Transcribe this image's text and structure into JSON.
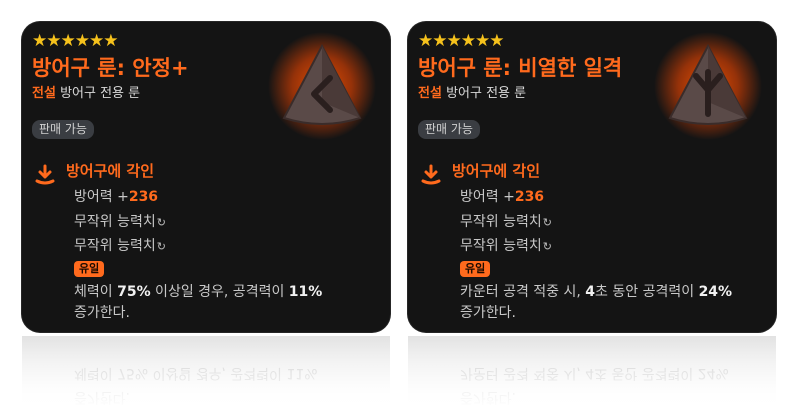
{
  "cards": [
    {
      "stars": "★★★★★★",
      "title": "방어구 룬: 안정+",
      "rarity": "전설",
      "subtitle": "방어구 전용 룬",
      "tag": "판매 가능",
      "rune_icon": "rune-stable-icon",
      "section_title": "방어구에 각인",
      "stat_label": "방어력 +",
      "stat_value": "236",
      "random1": "무작위 능력치",
      "random2": "무작위 능력치",
      "unique_label": "유일",
      "desc": {
        "p1": "체력이 ",
        "b1": "75%",
        "p2": " 이상일 경우, 공격력이 ",
        "b2": "11%",
        "p3": "증가한다."
      }
    },
    {
      "stars": "★★★★★★",
      "title": "방어구 룬: 비열한 일격",
      "rarity": "전설",
      "subtitle": "방어구 전용 룬",
      "tag": "판매 가능",
      "rune_icon": "rune-dirty-strike-icon",
      "section_title": "방어구에 각인",
      "stat_label": "방어력 +",
      "stat_value": "236",
      "random1": "무작위 능력치",
      "random2": "무작위 능력치",
      "unique_label": "유일",
      "desc": {
        "p1": "카운터 공격 적중 시, ",
        "b1": "4",
        "p2": "초 동안 공격력이 ",
        "b2": "24%",
        "p3": "증가한다."
      }
    }
  ],
  "colors": {
    "accent": "#ff6a1d",
    "star": "#f6c21c",
    "card_bg": "#141414"
  }
}
